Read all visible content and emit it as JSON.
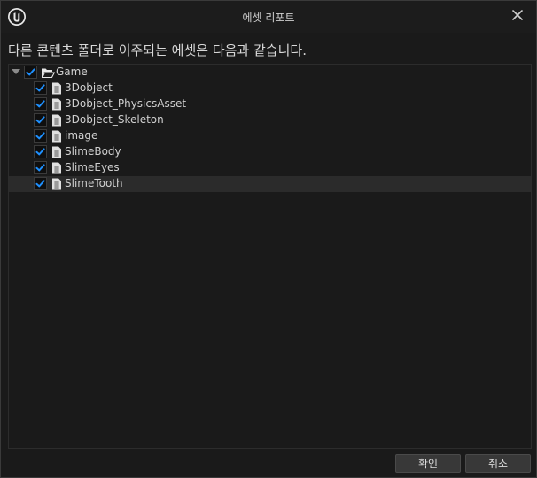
{
  "window": {
    "title": "에셋 리포트",
    "app_icon": "unreal-engine-logo-icon",
    "close_icon": "close-icon"
  },
  "message": "다른 콘텐츠 폴더로 이주되는 에셋은 다음과 같습니다.",
  "tree": {
    "root": {
      "label": "Game",
      "checked": true,
      "expanded": true,
      "icon": "folder-open-icon"
    },
    "items": [
      {
        "label": "3Dobject",
        "checked": true,
        "icon": "file-icon"
      },
      {
        "label": "3Dobject_PhysicsAsset",
        "checked": true,
        "icon": "file-icon"
      },
      {
        "label": "3Dobject_Skeleton",
        "checked": true,
        "icon": "file-icon"
      },
      {
        "label": "image",
        "checked": true,
        "icon": "file-icon"
      },
      {
        "label": "SlimeBody",
        "checked": true,
        "icon": "file-icon"
      },
      {
        "label": "SlimeEyes",
        "checked": true,
        "icon": "file-icon"
      },
      {
        "label": "SlimeTooth",
        "checked": true,
        "icon": "file-icon"
      }
    ]
  },
  "buttons": {
    "ok_label": "확인",
    "cancel_label": "취소"
  },
  "colors": {
    "checkmark": "#1e90ff",
    "background": "#1a1a1a",
    "highlight_row": "#2b2b2b"
  }
}
